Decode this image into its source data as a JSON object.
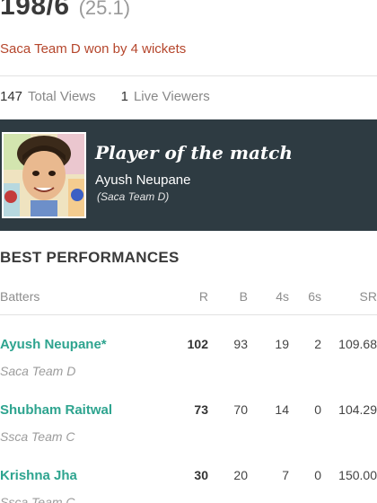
{
  "match": {
    "score": "198/6",
    "overs": "(25.1)",
    "result": "Saca Team D won by 4 wickets"
  },
  "views": {
    "total_count": "147",
    "total_label": "Total Views",
    "live_count": "1",
    "live_label": "Live Viewers"
  },
  "player_of_match": {
    "title": "Player of the match",
    "name": "Ayush Neupane",
    "team": "(Saca Team D)"
  },
  "best_performances": {
    "title": "BEST PERFORMANCES",
    "headers": {
      "batters": "Batters",
      "r": "R",
      "b": "B",
      "fours": "4s",
      "sixes": "6s",
      "sr": "SR"
    },
    "batters": [
      {
        "name": "Ayush Neupane*",
        "team": "Saca Team D",
        "r": "102",
        "b": "93",
        "fours": "19",
        "sixes": "2",
        "sr": "109.68"
      },
      {
        "name": "Shubham Raitwal",
        "team": "Ssca Team C",
        "r": "73",
        "b": "70",
        "fours": "14",
        "sixes": "0",
        "sr": "104.29"
      },
      {
        "name": "Krishna Jha",
        "team": "Ssca Team C",
        "r": "30",
        "b": "20",
        "fours": "7",
        "sixes": "0",
        "sr": "150.00"
      }
    ]
  },
  "colors": {
    "result_text": "#b5462c",
    "player_link": "#2ea48f",
    "potm_background": "#2e3b42"
  }
}
